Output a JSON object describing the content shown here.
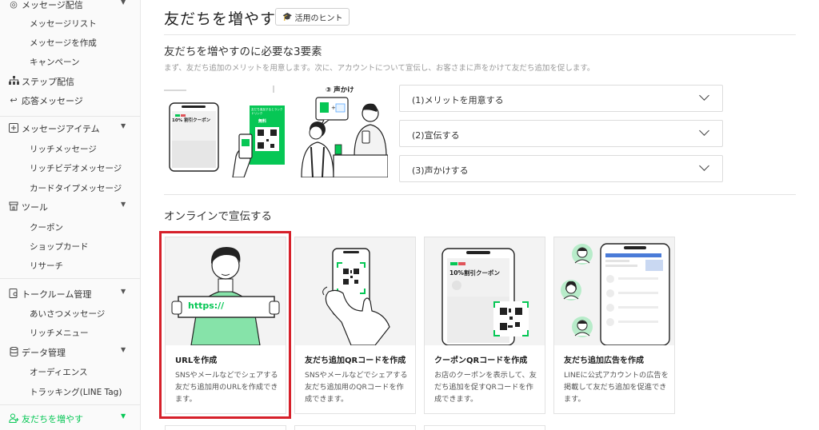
{
  "sidebar": {
    "sections": [
      {
        "icon": "message-icon",
        "label": "メッセージ配信",
        "items": [
          "メッセージリスト",
          "メッセージを作成",
          "キャンペーン"
        ]
      },
      {
        "icon": "step-icon",
        "label": "ステップ配信",
        "items": []
      },
      {
        "icon": "reply-icon",
        "label": "応答メッセージ",
        "items": []
      },
      {
        "icon": "plus-box-icon",
        "label": "メッセージアイテム",
        "items": [
          "リッチメッセージ",
          "リッチビデオメッセージ",
          "カードタイプメッセージ"
        ]
      },
      {
        "icon": "shop-icon",
        "label": "ツール",
        "items": [
          "クーポン",
          "ショップカード",
          "リサーチ"
        ]
      },
      {
        "icon": "chat-room-icon",
        "label": "トークルーム管理",
        "items": [
          "あいさつメッセージ",
          "リッチメニュー"
        ]
      },
      {
        "icon": "database-icon",
        "label": "データ管理",
        "items": [
          "オーディエンス",
          "トラッキング(LINE Tag)"
        ]
      },
      {
        "icon": "add-friend-icon",
        "label": "友だちを増やす",
        "items": []
      }
    ],
    "active": "友だちを増やす",
    "accent": "#06c755"
  },
  "header": {
    "title": "友だちを増やす",
    "hint_label": "活用のヒント"
  },
  "requirements": {
    "title": "友だちを増やすのに必要な3要素",
    "description": "まず、友だち追加のメリットを用意します。次に、アカウントについて宣伝し、お客さまに声をかけて友だち追加を促します。",
    "illustration": {
      "coupon_label": "10% 割引クーポン",
      "qr_caption_small": "友だち追加するとランクドリンク",
      "qr_caption_main": "無料",
      "step3_label": "③ 声かけ"
    },
    "accordions": [
      "(1)メリットを用意する",
      "(2)宣伝する",
      "(3)声かけする"
    ]
  },
  "online": {
    "title": "オンラインで宣伝する",
    "cards": [
      {
        "title": "URLを作成",
        "description": "SNSやメールなどでシェアする友だち追加用のURLを作成できます。",
        "image_text": "https://"
      },
      {
        "title": "友だち追加QRコードを作成",
        "description": "SNSやメールなどでシェアする友だち追加用のQRコードを作成できます。",
        "image_text": ""
      },
      {
        "title": "クーポンQRコードを作成",
        "description": "お店のクーポンを表示して、友だち追加を促すQRコードを作成できます。",
        "image_text": "10%割引クーポン"
      },
      {
        "title": "友だち追加広告を作成",
        "description": "LINEに公式アカウントの広告を掲載して友だち追加を促進できます。",
        "image_text": ""
      }
    ],
    "highlight_color": "#d6202a"
  }
}
